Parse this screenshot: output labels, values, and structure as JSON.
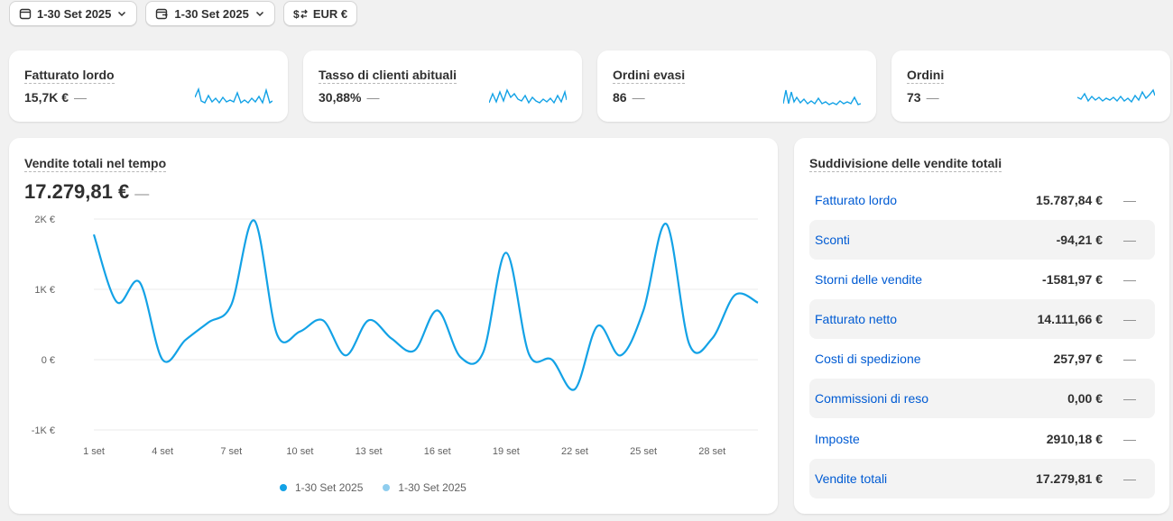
{
  "toolbar": {
    "date_range": "1-30 Set 2025",
    "compare_range": "1-30 Set 2025",
    "currency": "EUR €"
  },
  "kpis": [
    {
      "title": "Fatturato lordo",
      "value": "15,7K €",
      "change": "—"
    },
    {
      "title": "Tasso di clienti abituali",
      "value": "30,88%",
      "change": "—"
    },
    {
      "title": "Ordini evasi",
      "value": "86",
      "change": "—"
    },
    {
      "title": "Ordini",
      "value": "73",
      "change": "—"
    }
  ],
  "sales_over_time": {
    "title": "Vendite totali nel tempo",
    "value": "17.279,81 €",
    "change": "—"
  },
  "breakdown": {
    "title": "Suddivisione delle vendite totali",
    "rows": [
      {
        "label": "Fatturato lordo",
        "value": "15.787,84 €",
        "change": "—"
      },
      {
        "label": "Sconti",
        "value": "-94,21 €",
        "change": "—"
      },
      {
        "label": "Storni delle vendite",
        "value": "-1581,97 €",
        "change": "—"
      },
      {
        "label": "Fatturato netto",
        "value": "14.111,66 €",
        "change": "—"
      },
      {
        "label": "Costi di spedizione",
        "value": "257,97 €",
        "change": "—"
      },
      {
        "label": "Commissioni di reso",
        "value": "0,00 €",
        "change": "—"
      },
      {
        "label": "Imposte",
        "value": "2910,18 €",
        "change": "—"
      },
      {
        "label": "Vendite totali",
        "value": "17.279,81 €",
        "change": "—"
      }
    ]
  },
  "colors": {
    "line_primary": "#13a2e6",
    "line_secondary": "#8fcdee",
    "link": "#005bd3"
  },
  "chart_data": {
    "type": "line",
    "title": "",
    "xlabel": "",
    "ylabel": "",
    "ylim": [
      -1000,
      2000
    ],
    "y_ticks": [
      "2K €",
      "1K €",
      "0 €",
      "-1K €"
    ],
    "y_tick_values": [
      2000,
      1000,
      0,
      -1000
    ],
    "x_ticks": [
      "1 set",
      "4 set",
      "7 set",
      "10 set",
      "13 set",
      "16 set",
      "19 set",
      "22 set",
      "25 set",
      "28 set"
    ],
    "x_tick_days": [
      1,
      4,
      7,
      10,
      13,
      16,
      19,
      22,
      25,
      28
    ],
    "x_range": [
      1,
      30
    ],
    "grid": true,
    "legend_position": "bottom",
    "series": [
      {
        "name": "1-30 Set 2025",
        "x": [
          1,
          2,
          3,
          4,
          5,
          6,
          7,
          8,
          9,
          10,
          11,
          12,
          13,
          14,
          15,
          16,
          17,
          18,
          19,
          20,
          21,
          22,
          23,
          24,
          25,
          26,
          27,
          28,
          29,
          30
        ],
        "values": [
          1780,
          820,
          1100,
          0,
          280,
          530,
          780,
          1980,
          360,
          400,
          560,
          60,
          560,
          300,
          130,
          700,
          40,
          100,
          1520,
          80,
          0,
          -420,
          480,
          60,
          700,
          1930,
          220,
          300,
          920,
          810
        ]
      },
      {
        "name": "1-30 Set 2025",
        "values": []
      }
    ]
  }
}
